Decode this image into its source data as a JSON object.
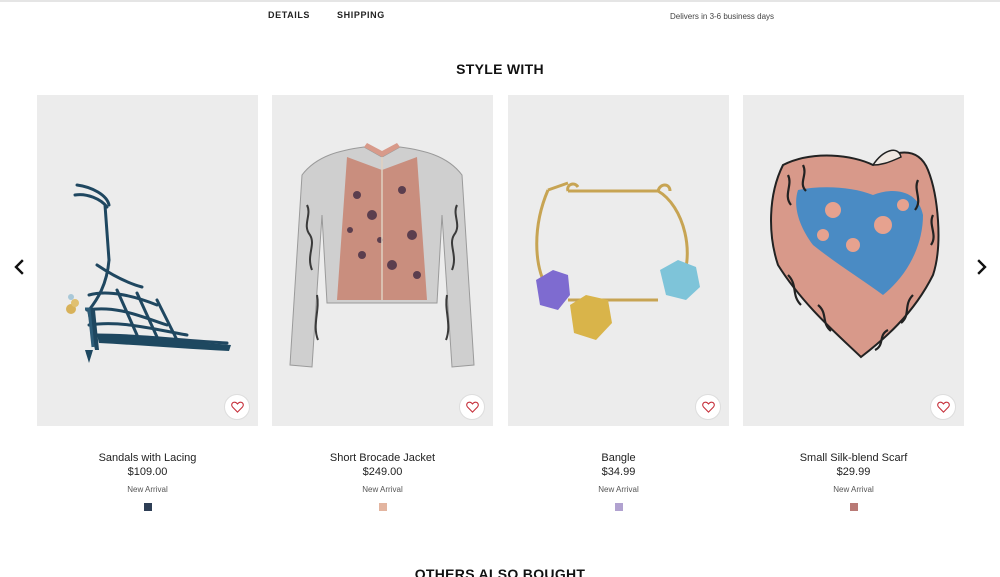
{
  "tabs": {
    "details": "DETAILS",
    "shipping": "SHIPPING"
  },
  "delivery_note": "Delivers in 3-6 business days",
  "style_with": {
    "title": "STYLE WITH"
  },
  "others": {
    "title": "OTHERS ALSO BOUGHT"
  },
  "products": [
    {
      "name": "Sandals with Lacing",
      "price": "$109.00",
      "badge": "New Arrival",
      "swatch_color": "#2e3e55"
    },
    {
      "name": "Short Brocade Jacket",
      "price": "$249.00",
      "badge": "New Arrival",
      "swatch_color": "#e3b5a0"
    },
    {
      "name": "Bangle",
      "price": "$34.99",
      "badge": "New Arrival",
      "swatch_color": "#b1a2d0"
    },
    {
      "name": "Small Silk-blend Scarf",
      "price": "$29.99",
      "badge": "New Arrival",
      "swatch_color": "#b97a76"
    }
  ],
  "icons": {
    "prev": "chevron-left-icon",
    "next": "chevron-right-icon",
    "favorite": "heart-icon"
  },
  "colors": {
    "accent_heart": "#c6303b",
    "image_bg": "#ececec"
  }
}
